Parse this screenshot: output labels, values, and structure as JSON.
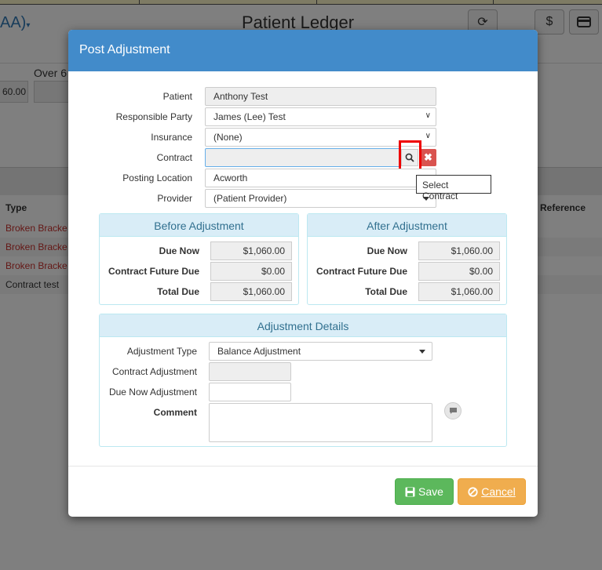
{
  "background": {
    "title_left": "AA)",
    "title": "Patient Ledger",
    "refresh_icon": "refresh-icon",
    "dollar_label": "$",
    "card_icon": "credit-card-icon",
    "over_label": "Over 6",
    "input_value": "60.00",
    "table": {
      "col_type": "Type",
      "col_reference": "Reference",
      "rows": [
        "Broken Bracke",
        "Broken Bracke",
        "Broken Bracke",
        "Contract test"
      ]
    }
  },
  "modal": {
    "title": "Post Adjustment",
    "form": {
      "patient_label": "Patient",
      "patient_value": "Anthony Test",
      "responsible_label": "Responsible Party",
      "responsible_value": "James (Lee) Test",
      "insurance_label": "Insurance",
      "insurance_value": "(None)",
      "contract_label": "Contract",
      "contract_value": "",
      "posting_label": "Posting Location",
      "posting_value": "Acworth",
      "provider_label": "Provider",
      "provider_value": "(Patient Provider)",
      "tooltip": "Select Contract"
    },
    "before": {
      "heading": "Before Adjustment",
      "due_now_label": "Due Now",
      "due_now": "$1,060.00",
      "future_label": "Contract Future Due",
      "future": "$0.00",
      "total_label": "Total Due",
      "total": "$1,060.00"
    },
    "after": {
      "heading": "After Adjustment",
      "due_now_label": "Due Now",
      "due_now": "$1,060.00",
      "future_label": "Contract Future Due",
      "future": "$0.00",
      "total_label": "Total Due",
      "total": "$1,060.00"
    },
    "details": {
      "heading": "Adjustment Details",
      "type_label": "Adjustment Type",
      "type_value": "Balance Adjustment",
      "contract_adj_label": "Contract Adjustment",
      "contract_adj_value": "",
      "due_now_adj_label": "Due Now Adjustment",
      "due_now_adj_value": "",
      "comment_label": "Comment",
      "comment_value": ""
    },
    "buttons": {
      "save": "Save",
      "cancel": "Cancel"
    }
  },
  "colors": {
    "header": "#428bca",
    "save": "#5cb85c",
    "cancel": "#f0ad4e",
    "clear": "#d9534f",
    "panel_heading": "#d9edf7"
  }
}
